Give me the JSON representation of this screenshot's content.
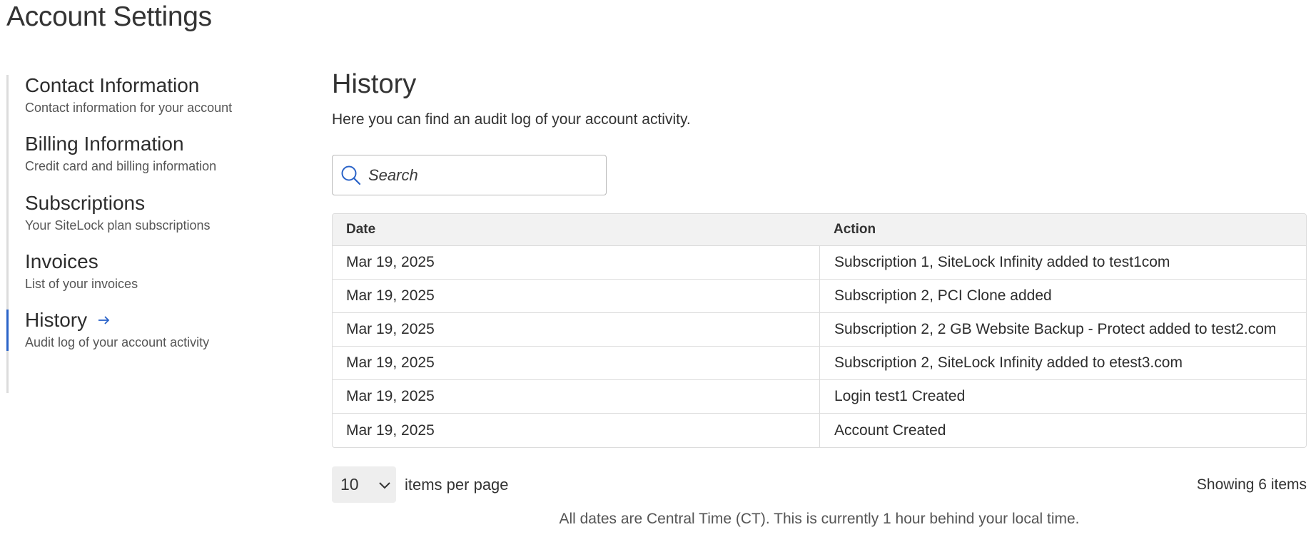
{
  "page": {
    "title": "Account Settings"
  },
  "sidebar": {
    "items": [
      {
        "title": "Contact Information",
        "subtitle": "Contact information for your account",
        "active": false
      },
      {
        "title": "Billing Information",
        "subtitle": "Credit card and billing information",
        "active": false
      },
      {
        "title": "Subscriptions",
        "subtitle": "Your SiteLock plan subscriptions",
        "active": false
      },
      {
        "title": "Invoices",
        "subtitle": "List of your invoices",
        "active": false
      },
      {
        "title": "History",
        "subtitle": "Audit log of your account activity",
        "active": true
      }
    ],
    "active_arrow_icon": "arrow-right-icon"
  },
  "main": {
    "title": "History",
    "description": "Here you can find an audit log of your account activity.",
    "search": {
      "placeholder": "Search",
      "value": "",
      "icon": "search-icon"
    },
    "table": {
      "columns": [
        "Date",
        "Action"
      ],
      "rows": [
        {
          "date": "Mar 19, 2025",
          "action": "Subscription 1, SiteLock Infinity added to test1com"
        },
        {
          "date": "Mar 19, 2025",
          "action": "Subscription 2, PCI Clone added"
        },
        {
          "date": "Mar 19, 2025",
          "action": "Subscription 2, 2 GB Website Backup - Protect added to test2.com"
        },
        {
          "date": "Mar 19, 2025",
          "action": "Subscription 2, SiteLock Infinity added to etest3.com"
        },
        {
          "date": "Mar 19, 2025",
          "action": "Login test1 Created"
        },
        {
          "date": "Mar 19, 2025",
          "action": "Account Created"
        }
      ]
    },
    "pager": {
      "page_size": "10",
      "items_per_page_label": "items per page",
      "showing_label": "Showing 6 items"
    },
    "footnote": "All dates are Central Time (CT). This is currently 1 hour behind your local time."
  },
  "colors": {
    "accent": "#2a63c8",
    "border": "#dcdcdc",
    "header_bg": "#f2f2f2"
  }
}
